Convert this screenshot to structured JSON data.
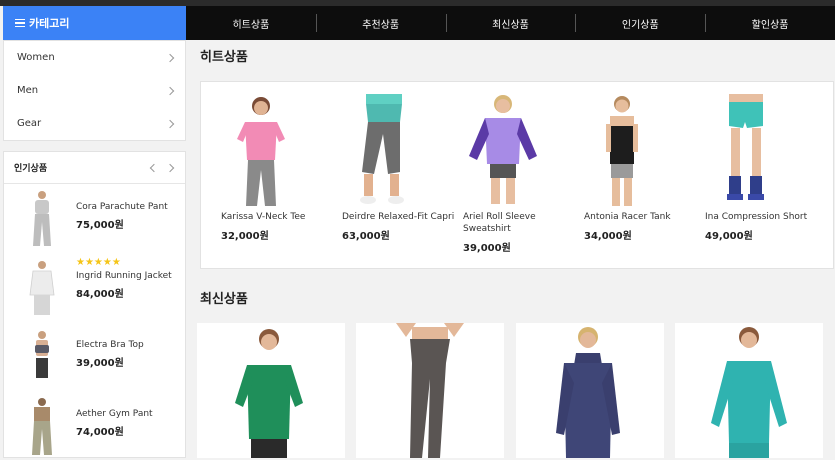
{
  "header": {
    "category_label": "카테고리"
  },
  "topnav": [
    {
      "label": "히트상품"
    },
    {
      "label": "추천상품"
    },
    {
      "label": "최신상품"
    },
    {
      "label": "인기상품"
    },
    {
      "label": "할인상품"
    }
  ],
  "categories": [
    {
      "label": "Women"
    },
    {
      "label": "Men"
    },
    {
      "label": "Gear"
    }
  ],
  "popular": {
    "title": "인기상품",
    "items": [
      {
        "name": "Cora Parachute Pant",
        "price": "75,000원",
        "stars": ""
      },
      {
        "name": "Ingrid Running Jacket",
        "price": "84,000원",
        "stars": "★★★★★"
      },
      {
        "name": "Electra Bra Top",
        "price": "39,000원",
        "stars": ""
      },
      {
        "name": "Aether Gym Pant",
        "price": "74,000원",
        "stars": ""
      }
    ]
  },
  "hits": {
    "title": "히트상품",
    "items": [
      {
        "name": "Karissa V-Neck Tee",
        "price": "32,000원"
      },
      {
        "name": "Deirdre Relaxed-Fit Capri",
        "price": "63,000원"
      },
      {
        "name": "Ariel Roll Sleeve Sweatshirt",
        "price": "39,000원"
      },
      {
        "name": "Antonia Racer Tank",
        "price": "34,000원"
      },
      {
        "name": "Ina Compression Short",
        "price": "49,000원"
      }
    ]
  },
  "new_products": {
    "title": "최신상품"
  },
  "colors": {
    "accent": "#3b82f6",
    "nav_bg": "#0d0d0d",
    "star": "#f5c518"
  }
}
